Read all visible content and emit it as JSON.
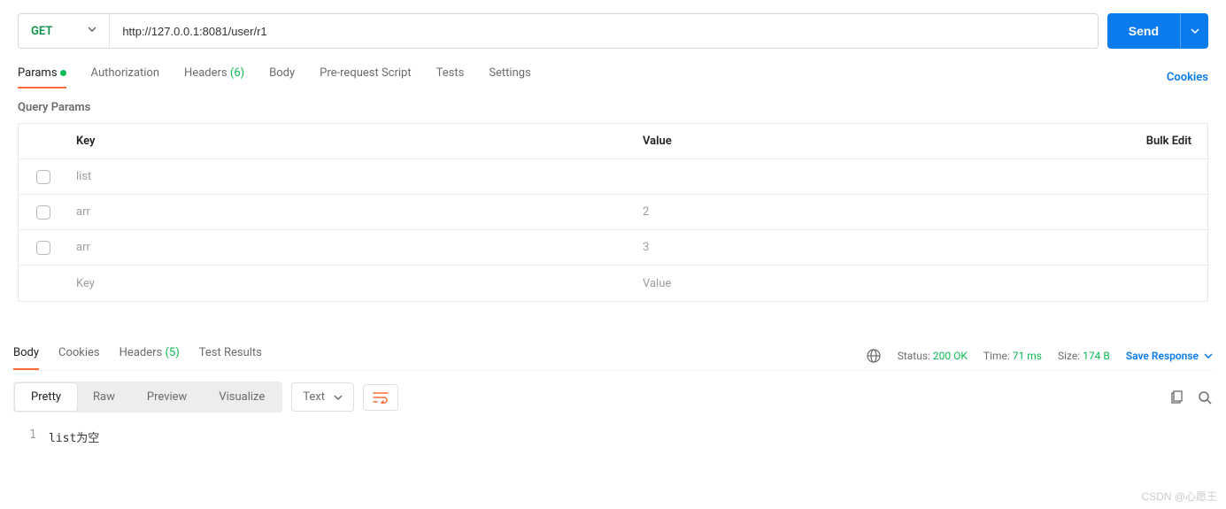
{
  "request": {
    "method": "GET",
    "url": "http://127.0.0.1:8081/user/r1",
    "send_label": "Send"
  },
  "tabs": {
    "params": "Params",
    "auth": "Authorization",
    "headers": "Headers",
    "headers_count": "(6)",
    "body": "Body",
    "prereq": "Pre-request Script",
    "tests": "Tests",
    "settings": "Settings",
    "cookies": "Cookies"
  },
  "query": {
    "title": "Query Params",
    "key_header": "Key",
    "value_header": "Value",
    "bulk": "Bulk Edit",
    "rows": [
      {
        "key": "list",
        "value": ""
      },
      {
        "key": "arr",
        "value": "2"
      },
      {
        "key": "arr",
        "value": "3"
      }
    ],
    "placeholder_key": "Key",
    "placeholder_value": "Value"
  },
  "response": {
    "tabs": {
      "body": "Body",
      "cookies": "Cookies",
      "headers": "Headers",
      "headers_count": "(5)",
      "tests": "Test Results"
    },
    "status_label": "Status:",
    "status_value": "200 OK",
    "time_label": "Time:",
    "time_value": "71 ms",
    "size_label": "Size:",
    "size_value": "174 B",
    "save": "Save Response",
    "views": {
      "pretty": "Pretty",
      "raw": "Raw",
      "preview": "Preview",
      "visualize": "Visualize"
    },
    "format": "Text",
    "body_lines": [
      {
        "n": "1",
        "t": "list为空"
      }
    ]
  },
  "watermark": "CSDN @心愿王"
}
